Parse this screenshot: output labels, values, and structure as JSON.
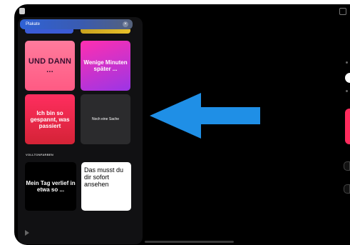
{
  "panel": {
    "title": "Plakate",
    "close_symbol": "×",
    "section_label": "VOLLTONFARBEN",
    "tiles": [
      {
        "text": "UND DANN ..."
      },
      {
        "text": "Wenige Minuten später ..."
      },
      {
        "text": "Ich bin so gespannt, was passiert"
      },
      {
        "text": "Noch eine Sache"
      },
      {
        "text": "Mein Tag verlief in etwa so ..."
      },
      {
        "text": "Das musst du dir sofort ansehen"
      }
    ]
  },
  "colors": {
    "arrow": "#1f8fe6",
    "header_blue": "#2f62d6",
    "accent_red": "#ff2b5d"
  },
  "icons": [
    "close-icon",
    "play-icon",
    "window-icon",
    "arrow-left-icon"
  ]
}
